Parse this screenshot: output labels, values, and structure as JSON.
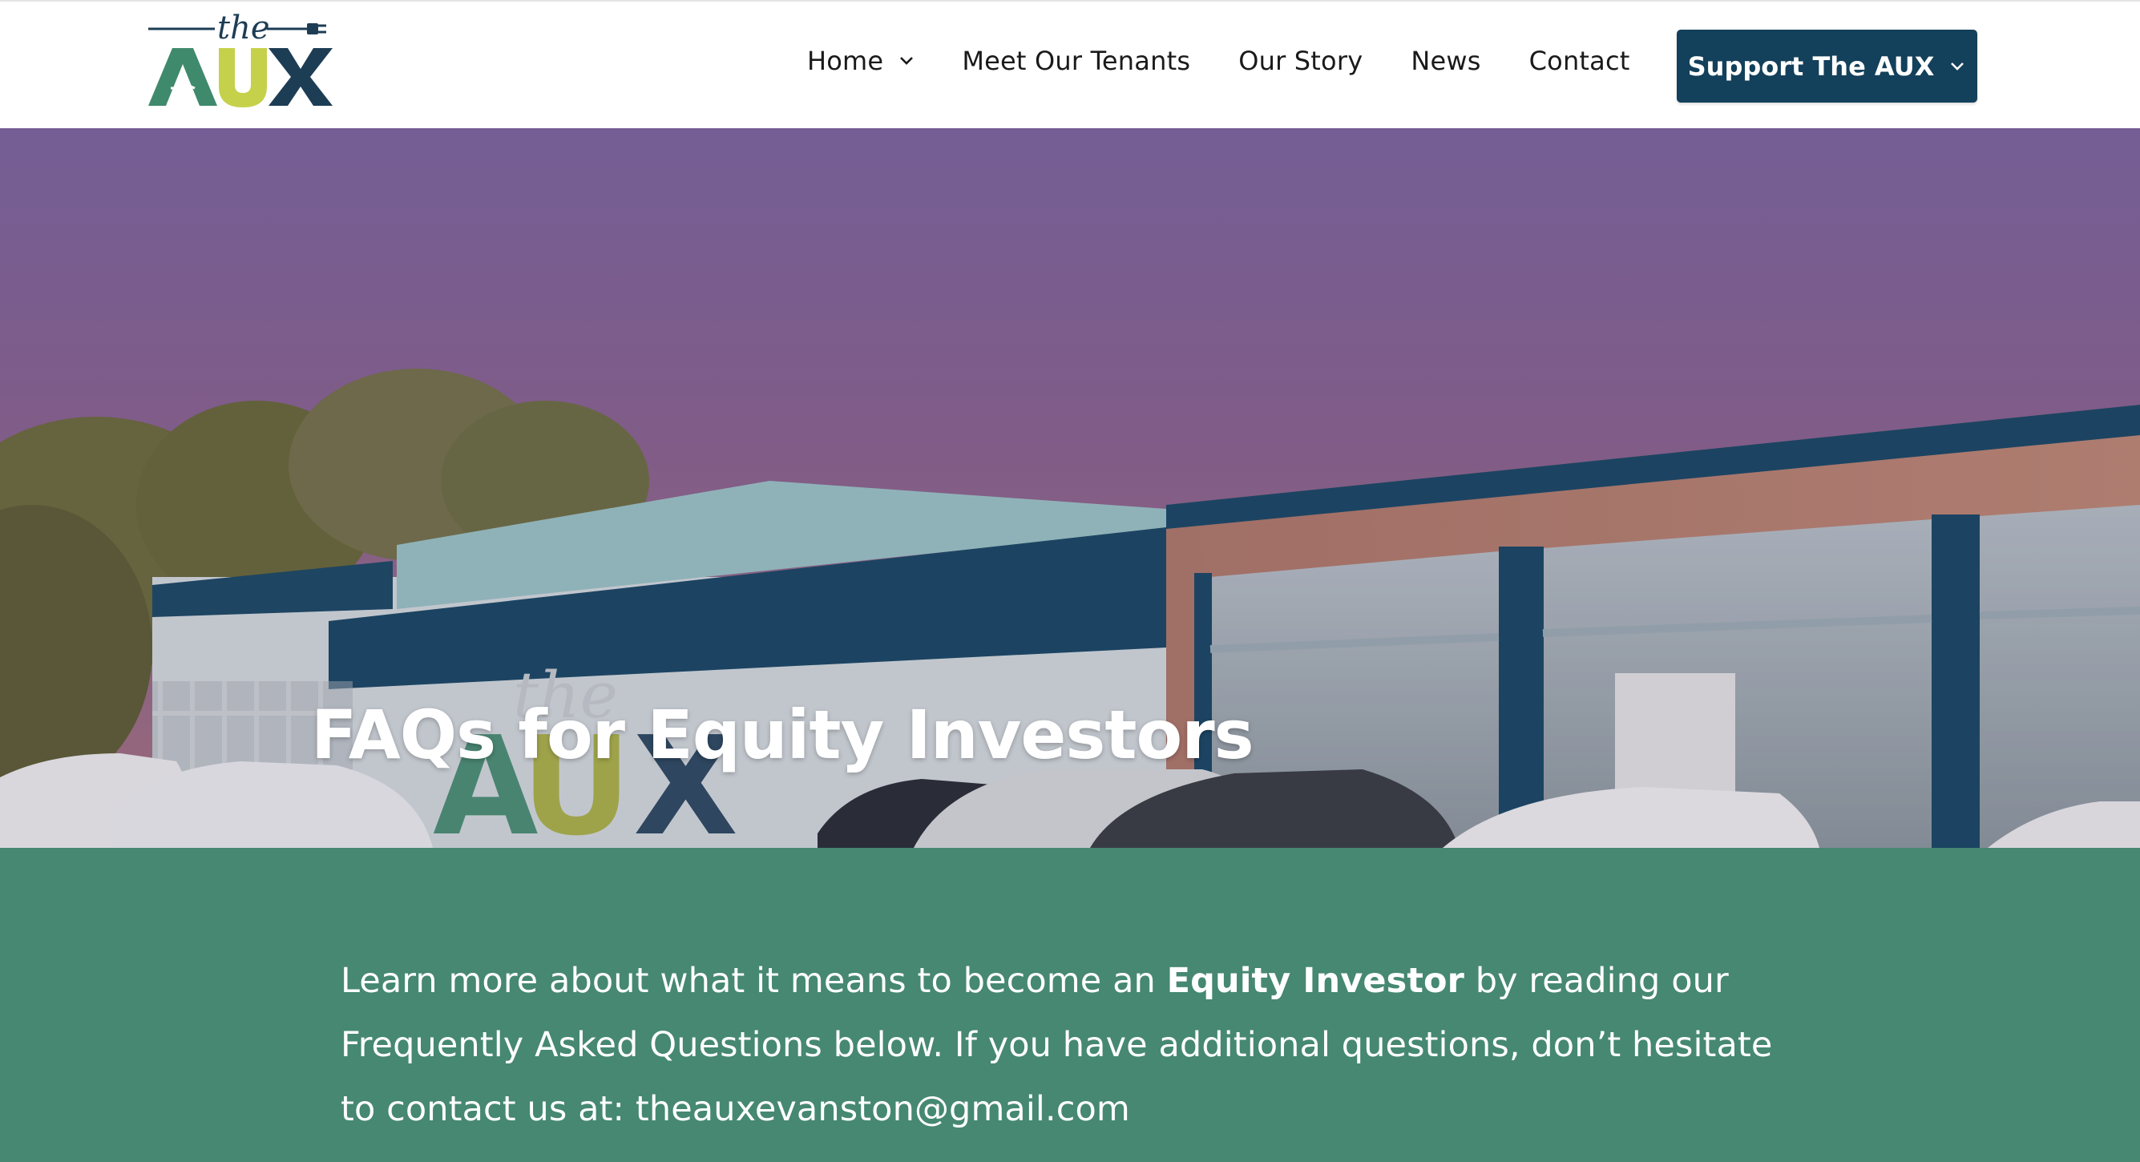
{
  "brand": {
    "logo_script": "the",
    "logo_letters": [
      "A",
      "U",
      "X"
    ]
  },
  "nav": {
    "items": [
      {
        "label": "Home",
        "has_dropdown": true
      },
      {
        "label": "Meet Our Tenants",
        "has_dropdown": false
      },
      {
        "label": "Our Story",
        "has_dropdown": false
      },
      {
        "label": "News",
        "has_dropdown": false
      },
      {
        "label": "Contact",
        "has_dropdown": false
      }
    ],
    "cta": {
      "label": "Support The AUX",
      "has_dropdown": true
    }
  },
  "hero": {
    "title": "FAQs for Equity Investors",
    "image_description_icon": "building-rendering-image"
  },
  "intro": {
    "part1": "Learn more about what it means to become an ",
    "bold": "Equity Investor",
    "part2": " by reading our Frequently Asked Questions below. If you have additional questions, don’t hesitate to contact us at: ",
    "email": "theauxevanston@gmail.com"
  },
  "colors": {
    "navy": "#13405a",
    "green": "#468871",
    "lime": "#c5d14a",
    "logo_green": "#3f8a6c",
    "logo_navy": "#1d3d55"
  }
}
